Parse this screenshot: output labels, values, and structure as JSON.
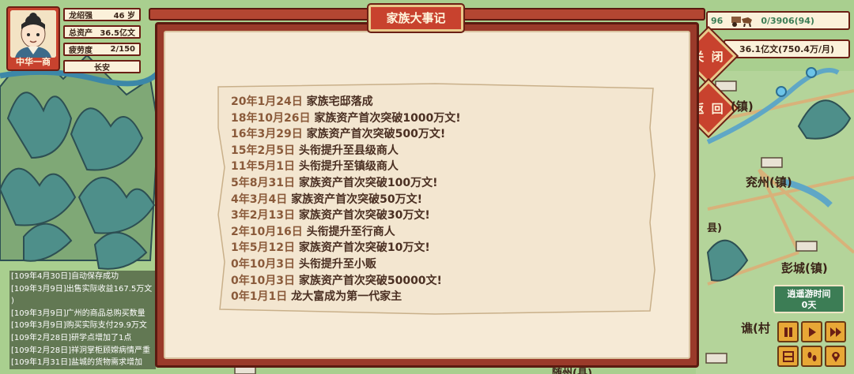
{
  "player": {
    "name": "龙绍强",
    "age": "46 岁",
    "assets_label": "总资产",
    "assets_value": "36.5亿文",
    "fatigue_label": "疲劳度",
    "fatigue_value": "2/150",
    "rank": "中华一商",
    "city": "长安"
  },
  "resources": {
    "partial_left": "96",
    "carriage_value": "0/3906(94)",
    "money_value": "36.1亿文(750.4万/月)"
  },
  "side_buttons": {
    "close_label": "关 闭",
    "back_label": "返 回"
  },
  "dialog": {
    "title": "家族大事记",
    "events": [
      {
        "date": "20年1月24日",
        "text": "家族宅邸落成"
      },
      {
        "date": "18年10月26日",
        "text": "家族资产首次突破1000万文!"
      },
      {
        "date": "16年3月29日",
        "text": "家族资产首次突破500万文!"
      },
      {
        "date": "15年2月5日",
        "text": "头衔提升至县级商人"
      },
      {
        "date": "11年5月1日",
        "text": "头衔提升至镇级商人"
      },
      {
        "date": "5年8月31日",
        "text": "家族资产首次突破100万文!"
      },
      {
        "date": "4年3月4日",
        "text": "家族资产首次突破50万文!"
      },
      {
        "date": "3年2月13日",
        "text": "家族资产首次突破30万文!"
      },
      {
        "date": "2年10月16日",
        "text": "头衔提升至行商人"
      },
      {
        "date": "1年5月12日",
        "text": "家族资产首次突破10万文!"
      },
      {
        "date": "0年10月3日",
        "text": "头衔提升至小贩"
      },
      {
        "date": "0年10月3日",
        "text": "家族资产首次突破50000文!"
      },
      {
        "date": "0年1月1日",
        "text": "龙大富成为第一代家主"
      }
    ]
  },
  "log": [
    "[109年4月30日]自动保存成功",
    "[109年3月9日]出售实际收益167.5万文",
    ")",
    "[109年3月9日]广州的商品总购买数量",
    "[109年3月9日]购买实际支付29.9万文",
    "[109年2月28日]研学点增加了1点",
    "[109年2月28日]祥泂掌柜顾嫦病情严重",
    "[109年1月31日]盐城的货物需求增加"
  ],
  "map_labels": {
    "town1": "(镇)",
    "town2": "兖州(镇)",
    "town3": "彭城(镇)",
    "town4": "谯(村",
    "town5": "随州(县)",
    "partial_mark": "县)"
  },
  "travel": {
    "label": "逍遥游时间",
    "value": "0天"
  },
  "colors": {
    "frame_red": "#c8422e",
    "paper": "#f6ead6",
    "text_brown": "#4a2f22",
    "gold": "#e8a736"
  }
}
